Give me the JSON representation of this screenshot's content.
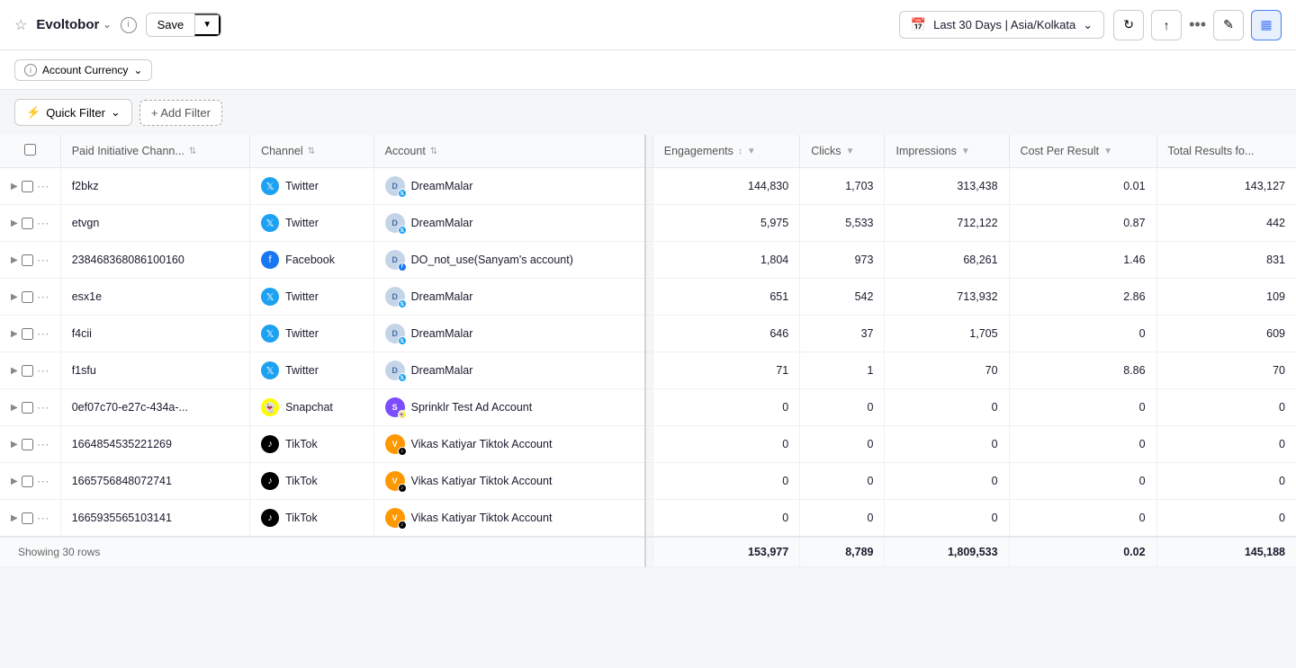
{
  "header": {
    "star_label": "☆",
    "app_name": "Evoltobor",
    "chevron": "⌄",
    "info": "i",
    "save_label": "Save",
    "save_arrow": "▼",
    "date_range": "Last 30 Days | Asia/Kolkata",
    "date_chevron": "⌄",
    "refresh_icon": "↻",
    "export_icon": "↑",
    "more_icon": "•••",
    "edit_icon": "✎",
    "chart_icon": "▦"
  },
  "subbar": {
    "currency_icon": "i",
    "currency_label": "Account Currency",
    "currency_chevron": "⌄"
  },
  "filters": {
    "quick_filter_label": "Quick Filter",
    "quick_filter_chevron": "⌄",
    "add_filter_label": "+ Add Filter"
  },
  "table": {
    "columns": [
      {
        "id": "initiative",
        "label": "Paid Initiative Chann...",
        "sortable": true
      },
      {
        "id": "channel",
        "label": "Channel",
        "sortable": true
      },
      {
        "id": "account",
        "label": "Account",
        "sortable": true
      },
      {
        "id": "engagements",
        "label": "Engagements",
        "sortable": true
      },
      {
        "id": "clicks",
        "label": "Clicks",
        "sortable": true
      },
      {
        "id": "impressions",
        "label": "Impressions",
        "sortable": true
      },
      {
        "id": "cost_per_result",
        "label": "Cost Per Result",
        "sortable": true
      },
      {
        "id": "total_results",
        "label": "Total Results fo...",
        "sortable": true
      }
    ],
    "rows": [
      {
        "id": "f2bkz",
        "channel": "Twitter",
        "channel_type": "twitter",
        "account": "DreamMalar",
        "account_badge": "twitter",
        "engagements": "144,830",
        "clicks": "1,703",
        "impressions": "313,438",
        "cost_per_result": "0.01",
        "total_results": "143,127"
      },
      {
        "id": "etvgn",
        "channel": "Twitter",
        "channel_type": "twitter",
        "account": "DreamMalar",
        "account_badge": "twitter",
        "engagements": "5,975",
        "clicks": "5,533",
        "impressions": "712,122",
        "cost_per_result": "0.87",
        "total_results": "442"
      },
      {
        "id": "238468368086100160",
        "channel": "Facebook",
        "channel_type": "facebook",
        "account": "DO_not_use(Sanyam's account)",
        "account_badge": "facebook",
        "engagements": "1,804",
        "clicks": "973",
        "impressions": "68,261",
        "cost_per_result": "1.46",
        "total_results": "831"
      },
      {
        "id": "esx1e",
        "channel": "Twitter",
        "channel_type": "twitter",
        "account": "DreamMalar",
        "account_badge": "twitter",
        "engagements": "651",
        "clicks": "542",
        "impressions": "713,932",
        "cost_per_result": "2.86",
        "total_results": "109"
      },
      {
        "id": "f4cii",
        "channel": "Twitter",
        "channel_type": "twitter",
        "account": "DreamMalar",
        "account_badge": "twitter",
        "engagements": "646",
        "clicks": "37",
        "impressions": "1,705",
        "cost_per_result": "0",
        "total_results": "609"
      },
      {
        "id": "f1sfu",
        "channel": "Twitter",
        "channel_type": "twitter",
        "account": "DreamMalar",
        "account_badge": "twitter",
        "engagements": "71",
        "clicks": "1",
        "impressions": "70",
        "cost_per_result": "8.86",
        "total_results": "70"
      },
      {
        "id": "0ef07c70-e27c-434a-...",
        "channel": "Snapchat",
        "channel_type": "snapchat",
        "account": "Sprinklr Test Ad Account",
        "account_badge": "snapchat",
        "engagements": "0",
        "clicks": "0",
        "impressions": "0",
        "cost_per_result": "0",
        "total_results": "0"
      },
      {
        "id": "1664854535221269",
        "channel": "TikTok",
        "channel_type": "tiktok",
        "account": "Vikas Katiyar Tiktok Account",
        "account_badge": "tiktok",
        "engagements": "0",
        "clicks": "0",
        "impressions": "0",
        "cost_per_result": "0",
        "total_results": "0"
      },
      {
        "id": "1665756848072741",
        "channel": "TikTok",
        "channel_type": "tiktok",
        "account": "Vikas Katiyar Tiktok Account",
        "account_badge": "tiktok",
        "engagements": "0",
        "clicks": "0",
        "impressions": "0",
        "cost_per_result": "0",
        "total_results": "0"
      },
      {
        "id": "1665935565103141",
        "channel": "TikTok",
        "channel_type": "tiktok",
        "account": "Vikas Katiyar Tiktok Account",
        "account_badge": "tiktok",
        "engagements": "0",
        "clicks": "0",
        "impressions": "0",
        "cost_per_result": "0",
        "total_results": "0"
      }
    ],
    "footer": {
      "engagements": "153,977",
      "clicks": "8,789",
      "impressions": "1,809,533",
      "cost_per_result": "0.02",
      "total_results": "145,188"
    },
    "showing_rows": "Showing 30 rows"
  }
}
